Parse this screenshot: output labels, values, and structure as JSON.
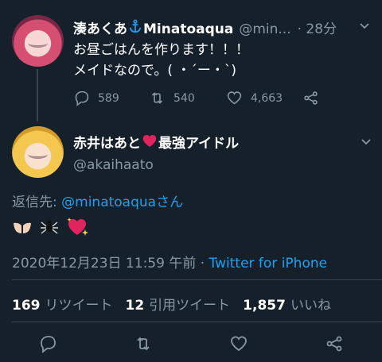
{
  "parent_tweet": {
    "display_name": "湊あくあ",
    "name_suffix": "Minatoaqua",
    "name_icon": "anchor-icon",
    "handle": "@min...",
    "time": "· 28分",
    "line1": "お昼ごはんを作ります！！！",
    "line2": "メイドなので。( ・´ー・`)",
    "replies": "589",
    "retweets": "540",
    "likes": "4,663"
  },
  "reply_tweet": {
    "display_name": "赤井はあと",
    "name_heart_icon": "red-heart-icon",
    "name_suffix": "最強アイドル",
    "handle": "@akaihaato",
    "reply_to_label": "返信先:",
    "reply_to_handle": "@minatoaquaさん",
    "emojis": [
      "palms-up-icon",
      "spider-icon",
      "sparkling-heart-icon"
    ],
    "timestamp": "2020年12月23日 11:59 午前 · ",
    "client": "Twitter for iPhone"
  },
  "stats": {
    "retweet_count": "169",
    "retweet_label": "リツイート",
    "quote_count": "12",
    "quote_label": "引用ツイート",
    "like_count": "1,857",
    "like_label": "いいね"
  },
  "colors": {
    "background": "#15202b",
    "accent": "#1da1f2",
    "muted": "#8899a6",
    "divider": "#38444d"
  }
}
